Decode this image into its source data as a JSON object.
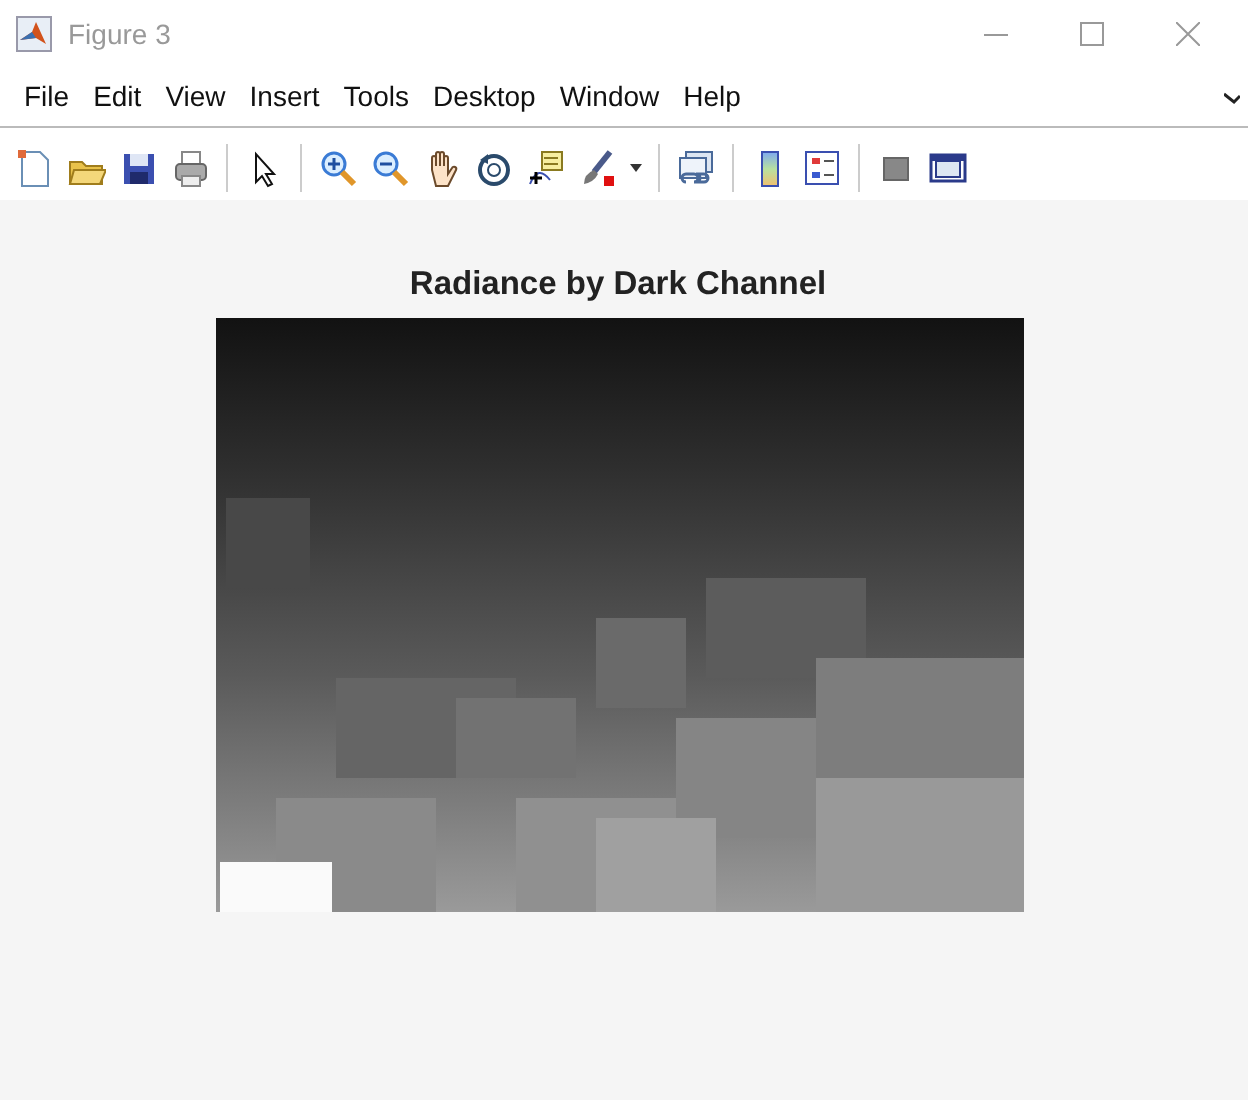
{
  "window": {
    "title": "Figure 3"
  },
  "menu": [
    {
      "label": "File"
    },
    {
      "label": "Edit"
    },
    {
      "label": "View"
    },
    {
      "label": "Insert"
    },
    {
      "label": "Tools"
    },
    {
      "label": "Desktop"
    },
    {
      "label": "Window"
    },
    {
      "label": "Help"
    }
  ],
  "axes": {
    "title": "Radiance by Dark Channel"
  }
}
